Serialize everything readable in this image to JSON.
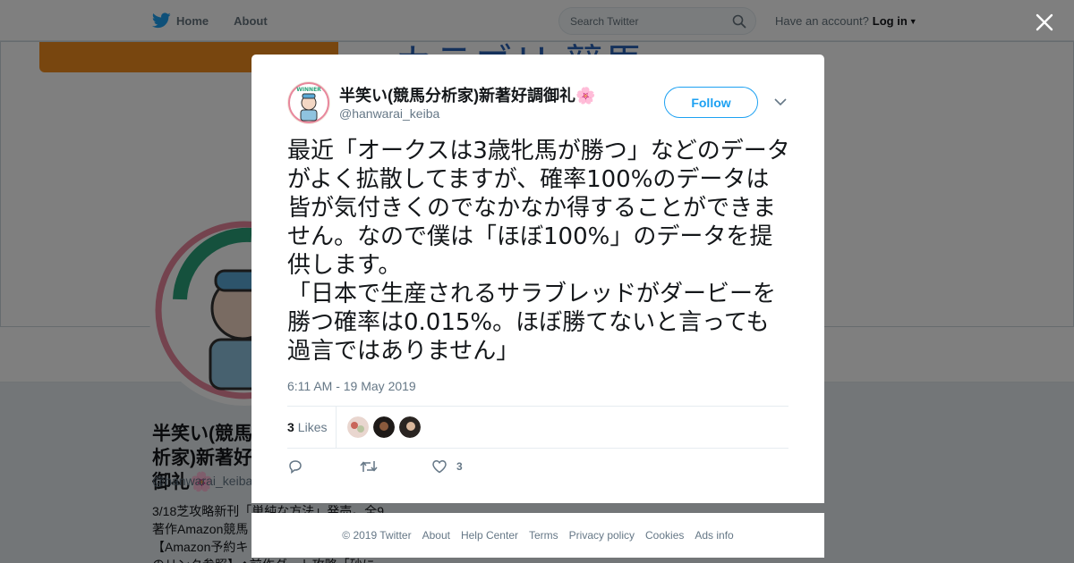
{
  "nav": {
    "home_label": "Home",
    "about_label": "About",
    "search_placeholder": "Search Twitter",
    "account_prompt": "Have an account?",
    "login_label": "Log in"
  },
  "background_profile": {
    "banner_text": "- カテゴリ 競馬",
    "name": "半笑い(競馬分析家)新著好調御礼🌸",
    "handle": "@hanwarai_keiba",
    "bio_lines": [
      "3/18芝攻略新刊「単純な方法」発売。全9",
      "著作Amazon競馬",
      "【Amazon予約キ",
      "のリンク参照】◆前作ダート攻略「砂に"
    ]
  },
  "tweet": {
    "author_name": "半笑い(競馬分析家)新著好調御礼🌸",
    "author_handle": "@hanwarai_keiba",
    "follow_label": "Follow",
    "text": "最近「オークスは3歳牝馬が勝つ」などのデータがよく拡散してますが、確率100%のデータは皆が気付きくのでなかなか得することができません。なので僕は「ほぼ100%」のデータを提供します。\n「日本で生産されるサラブレッドがダービーを勝つ確率は0.015%。ほぼ勝てないと言っても過言ではありません」",
    "timestamp": "6:11 AM - 19 May 2019",
    "likes_count": "3",
    "likes_label": "Likes",
    "like_action_count": "3",
    "avatar_text": "WINNER"
  },
  "footer": {
    "copyright": "© 2019 Twitter",
    "links": [
      "About",
      "Help Center",
      "Terms",
      "Privacy policy",
      "Cookies",
      "Ads info"
    ]
  },
  "colors": {
    "twitter_blue": "#1da1f2",
    "banner_orange": "#f08c1e",
    "banner_text_blue": "#2a62b6",
    "secondary_text": "#657786"
  }
}
